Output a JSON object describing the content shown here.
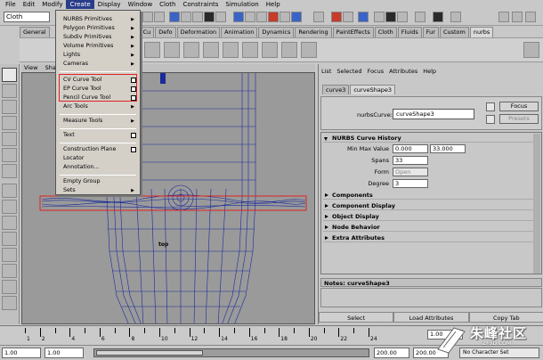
{
  "menubar": [
    "File",
    "Edit",
    "Modify",
    "Create",
    "Display",
    "Window",
    "Cloth",
    "Constraints",
    "Simulation",
    "Help"
  ],
  "statusline": {
    "mode": "Cloth"
  },
  "shelf": {
    "tabs": [
      "General",
      "Cu",
      "Defo",
      "Deformation",
      "Animation",
      "Dynamics",
      "Rendering",
      "PaintEffects",
      "Cloth",
      "Fluids",
      "Fur",
      "Custom",
      "nurbs"
    ]
  },
  "viewport": {
    "menu": [
      "View",
      "Shad"
    ],
    "label": "top"
  },
  "create_menu": {
    "items": [
      {
        "label": "NURBS Primitives",
        "arrow": true
      },
      {
        "label": "Polygon Primitives",
        "arrow": true
      },
      {
        "label": "Subdiv Primitives",
        "arrow": true
      },
      {
        "label": "Volume Primitives",
        "arrow": true
      },
      {
        "label": "Lights",
        "arrow": true
      },
      {
        "label": "Cameras",
        "arrow": true
      },
      {
        "label": "CV Curve Tool",
        "option": true
      },
      {
        "label": "EP Curve Tool",
        "option": true
      },
      {
        "label": "Pencil Curve Tool",
        "option": true
      },
      {
        "label": "Arc Tools",
        "arrow": true
      },
      {
        "label": "Measure Tools",
        "arrow": true
      },
      {
        "label": "Text",
        "option": true
      },
      {
        "label": "Construction Plane",
        "option": true
      },
      {
        "label": "Locator"
      },
      {
        "label": "Annotation..."
      },
      {
        "label": "Empty Group"
      },
      {
        "label": "Sets",
        "arrow": true
      }
    ]
  },
  "attribute_editor": {
    "menu": [
      "List",
      "Selected",
      "Focus",
      "Attributes",
      "Help"
    ],
    "tabs": [
      "curve3",
      "curveShape3"
    ],
    "nurbs_label": "nurbsCurve:",
    "nurbs_value": "curveShape3",
    "focus_button": "Focus",
    "presets_button": "Presets",
    "history_section": "NURBS Curve History",
    "minmax_label": "Min Max Value",
    "min_value": "0.000",
    "max_value": "33.000",
    "spans_label": "Spans",
    "spans_value": "33",
    "form_label": "Form",
    "form_value": "Open",
    "degree_label": "Degree",
    "degree_value": "3",
    "sections": [
      "Components",
      "Component Display",
      "Object Display",
      "Node Behavior",
      "Extra Attributes"
    ],
    "notes": "Notes: curveShape3",
    "bottom_buttons": [
      "Select",
      "Load Attributes",
      "Copy Tab"
    ]
  },
  "timeslider": {
    "ticks": [
      "1",
      "2",
      "4",
      "6",
      "8",
      "10",
      "12",
      "14",
      "16",
      "18",
      "20",
      "22",
      "24"
    ],
    "current": "1.00"
  },
  "range": {
    "start": "1.00",
    "start2": "1.00",
    "end": "200.00",
    "end2": "200.00",
    "charset": "No Character Set"
  },
  "watermark": {
    "text": "朱峰社区",
    "url": "ZF3D.COM"
  }
}
